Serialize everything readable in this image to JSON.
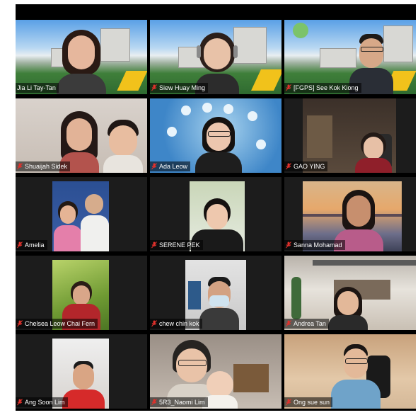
{
  "meeting": {
    "active_speaker_index": 0,
    "colors": {
      "grid_bg": "#000000",
      "active_border": "#cfe04a",
      "muted_mic": "#e0312c",
      "label_text": "#ffffff"
    },
    "participants": [
      {
        "name": "Jia Li Tay-Tan",
        "muted": false,
        "bg": "campus"
      },
      {
        "name": "Siew Huay Ming",
        "muted": true,
        "bg": "campus"
      },
      {
        "name": "[FGPS] See Kok Kiong",
        "muted": true,
        "bg": "campus"
      },
      {
        "name": "Shuaijah Sidek",
        "muted": true,
        "bg": "room-light"
      },
      {
        "name": "Ada Leow",
        "muted": true,
        "bg": "network"
      },
      {
        "name": "GAO YING",
        "muted": true,
        "bg": "room-dark"
      },
      {
        "name": "Amelia",
        "muted": true,
        "bg": "dark-inset"
      },
      {
        "name": "SERENE PEK",
        "muted": true,
        "bg": "dark-inset"
      },
      {
        "name": "Sanna Mohamad",
        "muted": true,
        "bg": "sunset"
      },
      {
        "name": "Chelsea Leow Chai Fern",
        "muted": true,
        "bg": "dark-inset"
      },
      {
        "name": "chew chin kok",
        "muted": true,
        "bg": "dark-inset"
      },
      {
        "name": "Andrea Tan",
        "muted": true,
        "bg": "patio"
      },
      {
        "name": "Ang Soon Lim",
        "muted": true,
        "bg": "dark-inset"
      },
      {
        "name": "5R3_Naomi Lim",
        "muted": true,
        "bg": "room-light"
      },
      {
        "name": "Ong sue sun",
        "muted": true,
        "bg": "room-warm"
      }
    ],
    "icons": {
      "muted": "mic-muted-icon",
      "unmuted": "mic-icon"
    }
  }
}
